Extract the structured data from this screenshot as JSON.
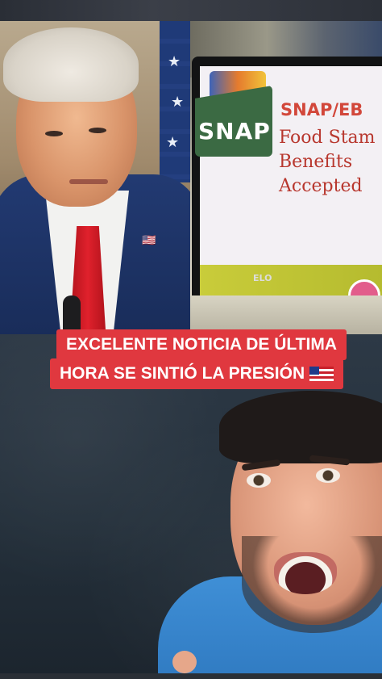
{
  "overlay": {
    "line1": "EXCELENTE NOTICIA DE ÚLTIMA",
    "line2": "HORA SE SINTIÓ LA PRESIÓN"
  },
  "monitor": {
    "logo_text": "SNAP",
    "headline": "SNAP/EB",
    "body": "Food Stam\nBenefits\nAccepted",
    "brand": "ELO"
  },
  "colors": {
    "banner": "#e0383f",
    "snap_green": "#3b6a43",
    "snap_text": "#d2473a",
    "shirt_blue": "#3f8fd6"
  },
  "icons": [
    "liberia-flag-icon",
    "flag-pin-icon",
    "snap-logo-icon"
  ]
}
